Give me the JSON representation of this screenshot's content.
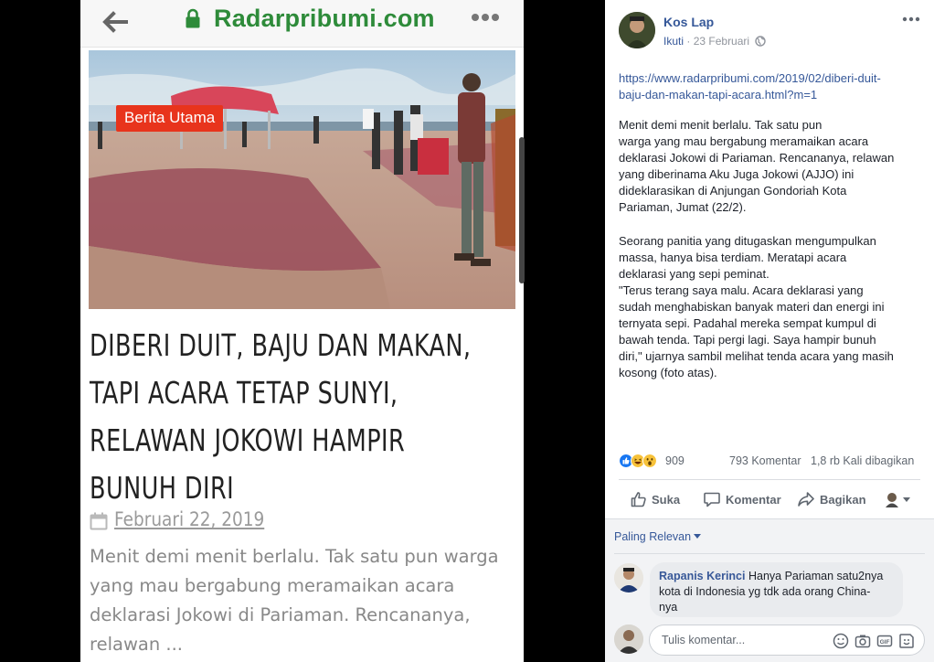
{
  "article": {
    "site_name": "Radarpribumi.com",
    "badge": "Berita Utama",
    "headline_lines": [
      "DIBERI DUIT, BAJU DAN MAKAN,",
      "TAPI ACARA TETAP SUNYI,",
      "RELAWAN JOKOWI HAMPIR",
      "BUNUH DIRI"
    ],
    "date": "Februari 22, 2019",
    "excerpt_lines": [
      "Menit demi menit berlalu. Tak satu pun  warga",
      "yang mau bergabung meramaikan acara",
      "deklarasi Jokowi di Pariaman. Rencananya,",
      "relawan ..."
    ]
  },
  "post": {
    "author": "Kos Lap",
    "follow": "Ikuti",
    "date": "23 Februari",
    "link": "https://www.radarpribumi.com/2019/02/diberi-duit-baju-dan-makan-tapi-acara.html?m=1",
    "link_lines": [
      "https://www.radarpribumi.com/2019/02/diberi-duit-",
      "baju-dan-makan-tapi-acara.html?m=1"
    ],
    "paragraph1_lines": [
      "Menit demi menit berlalu. Tak satu pun",
      "warga yang mau bergabung meramaikan acara",
      "deklarasi Jokowi di Pariaman. Rencananya, relawan",
      "yang diberinama Aku Juga Jokowi (AJJO) ini",
      "dideklarasikan di Anjungan Gondoriah Kota",
      "Pariaman, Jumat (22/2)."
    ],
    "paragraph2_lines": [
      "Seorang panitia yang ditugaskan mengumpulkan",
      "massa, hanya bisa terdiam. Meratapi acara",
      "deklarasi yang sepi peminat.",
      "\"Terus terang saya malu. Acara deklarasi yang",
      "sudah menghabiskan banyak materi dan energi ini",
      "ternyata sepi. Padahal mereka sempat kumpul di",
      "bawah tenda. Tapi pergi lagi. Saya hampir bunuh",
      "diri,\" ujarnya sambil melihat tenda acara yang masih",
      "kosong (foto atas)."
    ],
    "reaction_count": "909",
    "comment_count": "793 Komentar",
    "share_count": "1,8 rb Kali dibagikan",
    "actions": {
      "like": "Suka",
      "comment": "Komentar",
      "share": "Bagikan"
    },
    "sort_label": "Paling Relevan",
    "comment": {
      "author": "Rapanis Kerinci",
      "text_lines": [
        "Hanya Pariaman satu2nya",
        "kota di Indonesia yg tdk ada orang China-",
        "nya"
      ]
    },
    "composer_placeholder": "Tulis komentar..."
  },
  "colors": {
    "facebook_link": "#365899",
    "site_green": "#2e8b3a",
    "badge_red": "#e8341c"
  },
  "icons": [
    "back-arrow-icon",
    "lock-icon",
    "more-vert-icon",
    "calendar-icon",
    "globe-icon",
    "more-horiz-icon",
    "like-reaction-icon",
    "haha-reaction-icon",
    "wow-reaction-icon",
    "thumbs-up-icon",
    "comment-icon",
    "share-icon",
    "emoji-icon",
    "camera-icon",
    "gif-icon",
    "sticker-icon"
  ]
}
